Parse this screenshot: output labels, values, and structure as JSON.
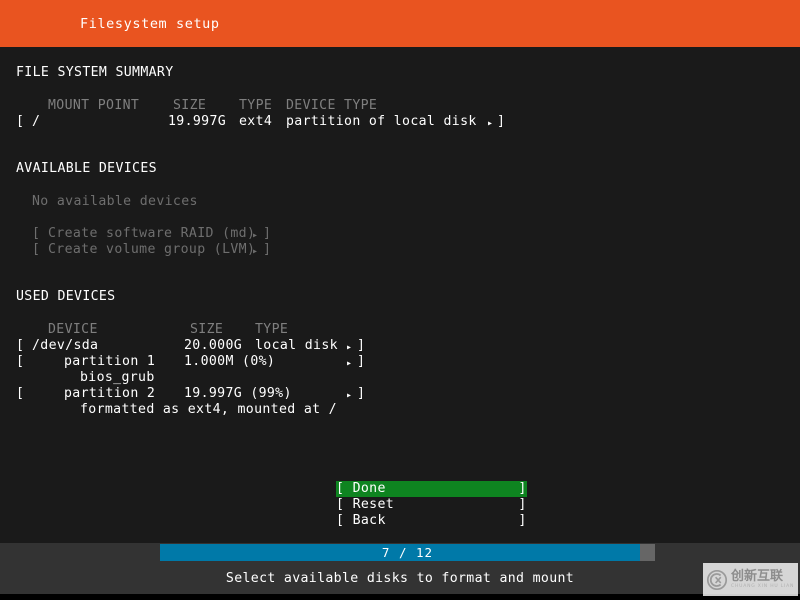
{
  "header": {
    "title": "Filesystem setup",
    "accent_color": "#e95420"
  },
  "background_color": "#1a1a1a",
  "filesystem_summary": {
    "section_label": "FILE SYSTEM SUMMARY",
    "columns": [
      "MOUNT POINT",
      "SIZE",
      "TYPE",
      "DEVICE TYPE"
    ],
    "rows": [
      {
        "open_bracket": "[",
        "mount_point": "/",
        "size": "19.997G",
        "type": "ext4",
        "device_type": "partition of local disk",
        "arrow": "▸",
        "close_bracket": "]"
      }
    ]
  },
  "available_devices": {
    "section_label": "AVAILABLE DEVICES",
    "empty_message": "No available devices",
    "actions": [
      {
        "open_bracket": "[",
        "label": "Create software RAID (md)",
        "arrow": "▸",
        "close_bracket": "]"
      },
      {
        "open_bracket": "[",
        "label": "Create volume group (LVM)",
        "arrow": "▸",
        "close_bracket": "]"
      }
    ]
  },
  "used_devices": {
    "section_label": "USED DEVICES",
    "columns": [
      "DEVICE",
      "SIZE",
      "TYPE"
    ],
    "rows": [
      {
        "open_bracket": "[",
        "device": "/dev/sda",
        "size": "20.000G",
        "type": "local disk",
        "arrow": "▸",
        "close_bracket": "]",
        "detail": ""
      },
      {
        "open_bracket": "[",
        "device": "partition 1",
        "size": "1.000M (0%)",
        "type": "",
        "arrow": "▸",
        "close_bracket": "]",
        "detail": "bios_grub"
      },
      {
        "open_bracket": "[",
        "device": "partition 2",
        "size": "19.997G (99%)",
        "type": "",
        "arrow": "▸",
        "close_bracket": "]",
        "detail": "formatted as ext4, mounted at /"
      }
    ]
  },
  "buttons": [
    {
      "text": "[ Done                ]",
      "name": "done",
      "selected": true,
      "highlight_color": "#0e8420"
    },
    {
      "text": "[ Reset               ]",
      "name": "reset",
      "selected": false
    },
    {
      "text": "[ Back                ]",
      "name": "back",
      "selected": false
    }
  ],
  "progress": {
    "label": "7 / 12",
    "current": 7,
    "total": 12,
    "fill_color": "#0079a8",
    "track_color": "#666666"
  },
  "footer": {
    "hint": "Select available disks to format and mount"
  },
  "watermark": {
    "chinese": "创新互联",
    "pinyin": "CHUANG XIN HU LIAN"
  }
}
